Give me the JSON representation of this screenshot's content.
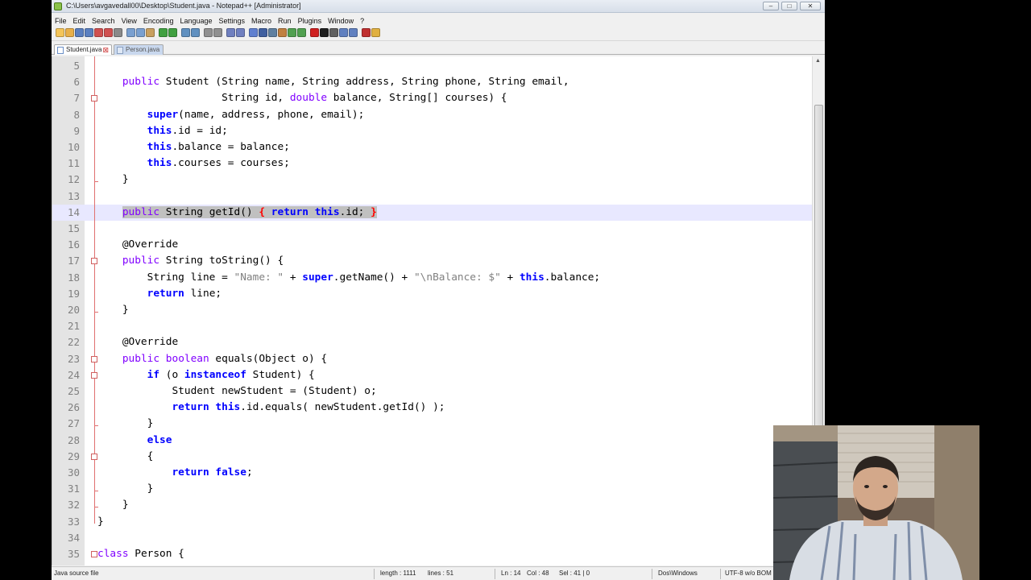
{
  "window": {
    "title": "C:\\Users\\avgavedall00\\Desktop\\Student.java - Notepad++ [Administrator]",
    "controls": {
      "minimize": "–",
      "maximize": "□",
      "close": "✕"
    }
  },
  "menubar": [
    "File",
    "Edit",
    "Search",
    "View",
    "Encoding",
    "Language",
    "Settings",
    "Macro",
    "Run",
    "Plugins",
    "Window",
    "?"
  ],
  "toolbar": {
    "icons": [
      "new-file-icon",
      "open-file-icon",
      "save-icon",
      "save-all-icon",
      "close-icon",
      "close-all-icon",
      "print-icon",
      "cut-icon",
      "copy-icon",
      "paste-icon",
      "undo-icon",
      "redo-icon",
      "find-icon",
      "replace-icon",
      "zoom-in-icon",
      "zoom-out-icon",
      "sync-v-icon",
      "sync-h-icon",
      "word-wrap-icon",
      "show-all-chars-icon",
      "indent-guide-icon",
      "user-lang-icon",
      "doc-map-icon",
      "function-list-icon",
      "record-macro-icon",
      "stop-macro-icon",
      "play-macro-icon",
      "run-macro-multi-icon",
      "save-macro-icon",
      "spell-check-icon",
      "plugin-icon"
    ]
  },
  "tabs": [
    {
      "label": "Student.java",
      "active": true,
      "close": "⊠"
    },
    {
      "label": "Person.java",
      "active": false
    }
  ],
  "editor": {
    "current_line": 14,
    "lines": [
      {
        "n": "5",
        "html": ""
      },
      {
        "n": "6",
        "html": "    <span class=\"kw2\">public</span> Student (String name, String address, String phone, String email,"
      },
      {
        "n": "7",
        "html": "                    String id, <span class=\"kw2\">double</span> balance, String[] courses) {"
      },
      {
        "n": "8",
        "html": "        <span class=\"kw\">super</span>(name, address, phone, email);"
      },
      {
        "n": "9",
        "html": "        <span class=\"kw\">this</span>.id = id;"
      },
      {
        "n": "10",
        "html": "        <span class=\"kw\">this</span>.balance = balance;"
      },
      {
        "n": "11",
        "html": "        <span class=\"kw\">this</span>.courses = courses;"
      },
      {
        "n": "12",
        "html": "    }"
      },
      {
        "n": "13",
        "html": ""
      },
      {
        "n": "14",
        "html": "    <span class=\"sel\"><span class=\"kw2\">public</span> String getId() <span class=\"br\">{</span> <span class=\"kw\">return</span> <span class=\"kw\">this</span>.id; <span class=\"br\">}</span></span>"
      },
      {
        "n": "15",
        "html": ""
      },
      {
        "n": "16",
        "html": "    @Override"
      },
      {
        "n": "17",
        "html": "    <span class=\"kw2\">public</span> String toString() {"
      },
      {
        "n": "18",
        "html": "        String line = <span class=\"str\">\"Name: \"</span> + <span class=\"kw\">super</span>.getName() + <span class=\"str\">\"\\nBalance: $\"</span> + <span class=\"kw\">this</span>.balance;"
      },
      {
        "n": "19",
        "html": "        <span class=\"kw\">return</span> line;"
      },
      {
        "n": "20",
        "html": "    }"
      },
      {
        "n": "21",
        "html": ""
      },
      {
        "n": "22",
        "html": "    @Override"
      },
      {
        "n": "23",
        "html": "    <span class=\"kw2\">public</span> <span class=\"kw2\">boolean</span> equals(Object o) {"
      },
      {
        "n": "24",
        "html": "        <span class=\"kw\">if</span> (o <span class=\"kw\">instanceof</span> Student) {"
      },
      {
        "n": "25",
        "html": "            Student newStudent = (Student) o;"
      },
      {
        "n": "26",
        "html": "            <span class=\"kw\">return</span> <span class=\"kw\">this</span>.id.equals( newStudent.getId() );"
      },
      {
        "n": "27",
        "html": "        }"
      },
      {
        "n": "28",
        "html": "        <span class=\"kw\">else</span>"
      },
      {
        "n": "29",
        "html": "        {"
      },
      {
        "n": "30",
        "html": "            <span class=\"kw\">return</span> <span class=\"kw\">false</span>;"
      },
      {
        "n": "31",
        "html": "        }"
      },
      {
        "n": "32",
        "html": "    }"
      },
      {
        "n": "33",
        "html": "}"
      },
      {
        "n": "34",
        "html": ""
      },
      {
        "n": "35",
        "html": "<span class=\"kw2\">class</span> Person {"
      }
    ]
  },
  "statusbar": {
    "file_type": "Java source file",
    "length": "length : 1111",
    "lines": "lines : 51",
    "ln": "Ln : 14",
    "col": "Col : 48",
    "sel": "Sel : 41 | 0",
    "eol": "Dos\\Windows",
    "encoding": "UTF-8 w/o BOM"
  },
  "colors": {
    "keyword": "#0000ff",
    "type_keyword": "#8000ff",
    "string": "#808080",
    "current_line_bg": "#e8e8ff",
    "brace_match": "#ff0000",
    "fold_margin": "#e07070"
  }
}
